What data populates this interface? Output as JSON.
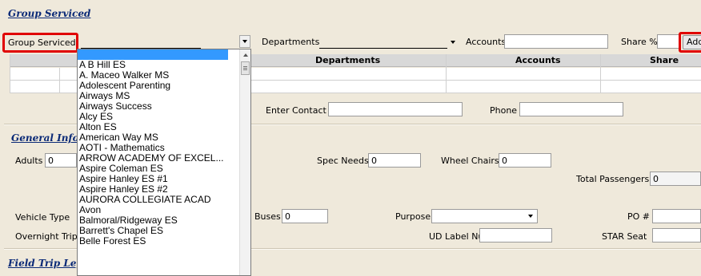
{
  "sections": {
    "group_serviced": "Group Serviced",
    "general_info": "General Info",
    "field_trip_legs": "Field Trip Legs"
  },
  "top_row": {
    "group_serviced_label": "Group Serviced",
    "departments_label": "Departments",
    "accounts_label": "Accounts",
    "share_label": "Share %",
    "add_button": "Add"
  },
  "grid": {
    "columns": [
      "Departments",
      "Accounts",
      "Share"
    ]
  },
  "contact": {
    "enter_contact_label": "Enter Contact",
    "phone_label": "Phone"
  },
  "general": {
    "adults_label": "Adults",
    "adults_value": "0",
    "spec_needs_label": "Spec Needs",
    "spec_needs_value": "0",
    "wheel_chairs_label": "Wheel Chairs",
    "wheel_chairs_value": "0",
    "total_passengers_label": "Total Passengers",
    "total_passengers_value": "0",
    "vehicle_type_label": "Vehicle Type",
    "buses_label": "Buses",
    "buses_value": "0",
    "purpose_label": "Purpose",
    "po_label": "PO #",
    "overnight_label": "Overnight Trip",
    "ud_label": "UD Label Num",
    "star_seat_label": "STAR Seat"
  },
  "dropdown": {
    "items": [
      "",
      "A B Hill ES",
      "A. Maceo Walker MS",
      "Adolescent Parenting",
      "Airways MS",
      "Airways Success",
      "Alcy ES",
      "Alton ES",
      "American Way MS",
      "AOTI - Mathematics",
      "ARROW ACADEMY OF EXCEL...",
      "Aspire Coleman ES",
      "Aspire Hanley ES #1",
      "Aspire Hanley ES #2",
      "AURORA COLLEGIATE ACAD",
      "Avon",
      "Balmoral/Ridgeway ES",
      "Barrett's Chapel ES",
      "Belle Forest ES"
    ]
  },
  "colors": {
    "background": "#efe9db",
    "section_title": "#0b2a77",
    "highlight": "#e00000",
    "selection": "#3399ff"
  }
}
